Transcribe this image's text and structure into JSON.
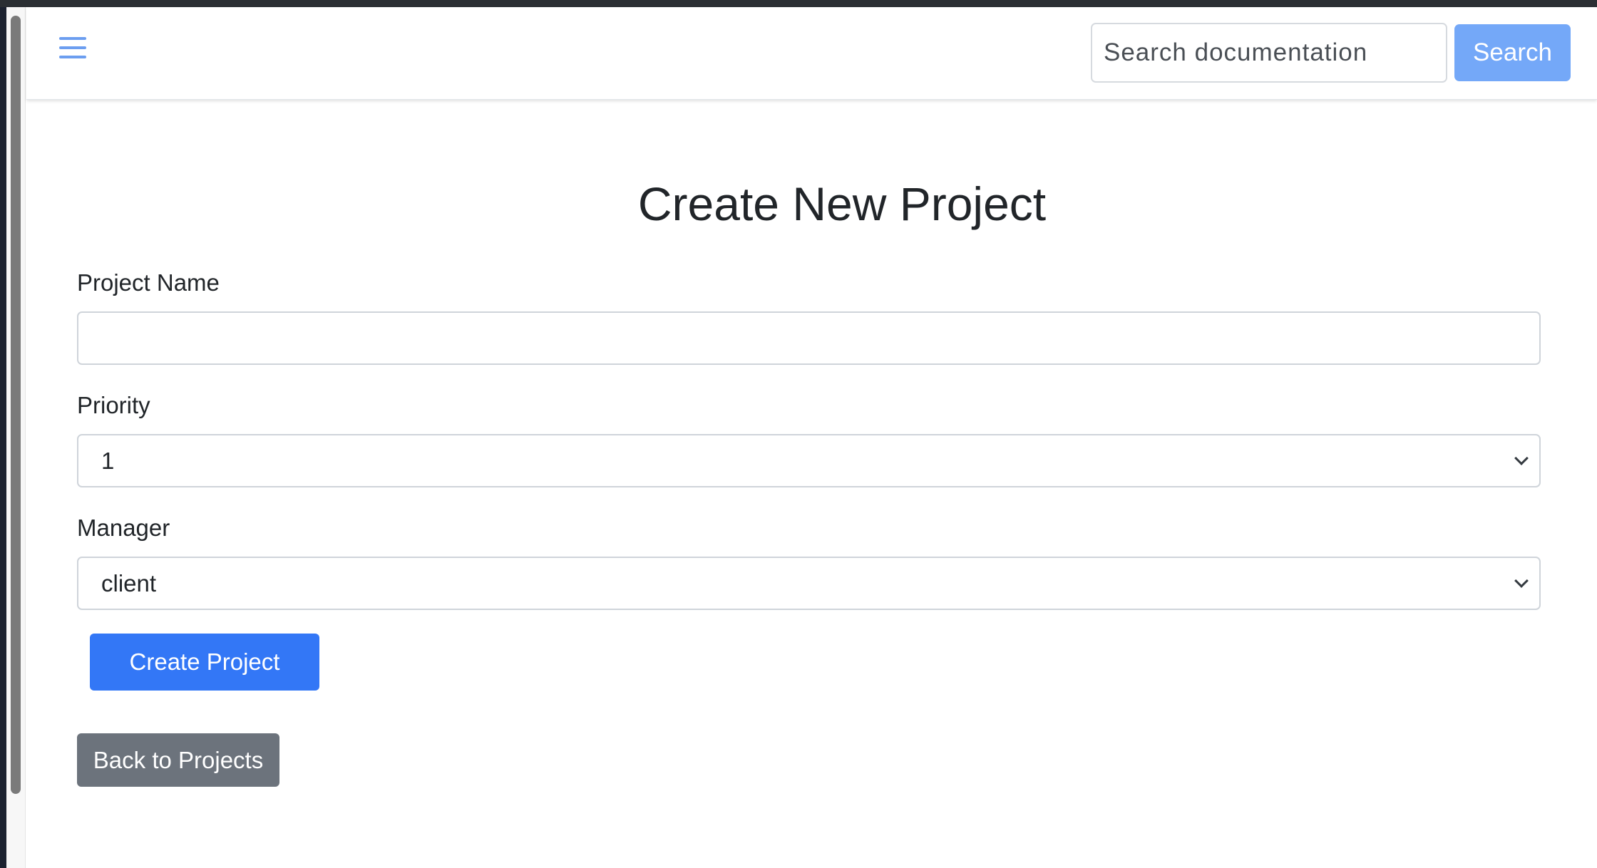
{
  "header": {
    "search_placeholder": "Search documentation",
    "search_value": "",
    "search_button_label": "Search",
    "menu_icon": "hamburger-menu-icon"
  },
  "form": {
    "title": "Create New Project",
    "project_name": {
      "label": "Project Name",
      "value": "",
      "placeholder": ""
    },
    "priority": {
      "label": "Priority",
      "selected": "1"
    },
    "manager": {
      "label": "Manager",
      "selected": "client"
    },
    "submit_label": "Create Project"
  },
  "back_button_label": "Back to Projects",
  "colors": {
    "primary": "#3377f6",
    "search_button": "#74a8f8",
    "secondary": "#6c737c",
    "menu_icon": "#6c9ef0"
  }
}
